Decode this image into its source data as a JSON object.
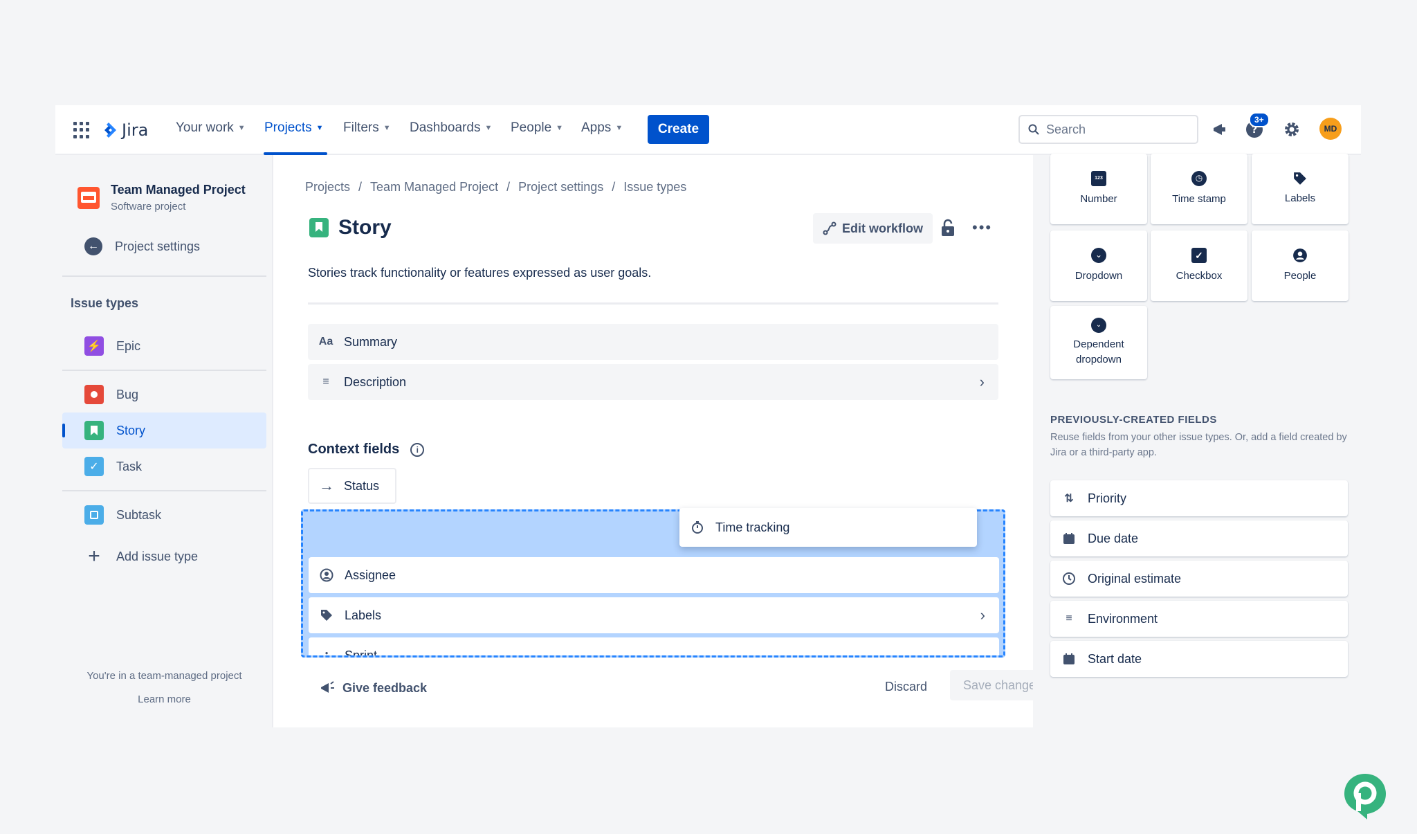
{
  "nav": {
    "logo_text": "Jira",
    "items": [
      {
        "label": "Your work"
      },
      {
        "label": "Projects"
      },
      {
        "label": "Filters"
      },
      {
        "label": "Dashboards"
      },
      {
        "label": "People"
      },
      {
        "label": "Apps"
      }
    ],
    "create_label": "Create",
    "search_placeholder": "Search",
    "notification_badge": "3+",
    "avatar_initials": "MD"
  },
  "sidebar": {
    "project_name": "Team Managed Project",
    "project_type": "Software project",
    "settings_label": "Project settings",
    "section_heading": "Issue types",
    "issue_types": [
      {
        "label": "Epic",
        "color": "#904ee2"
      },
      {
        "label": "Bug",
        "color": "#e5493a"
      },
      {
        "label": "Story",
        "color": "#36b37e"
      },
      {
        "label": "Task",
        "color": "#4bade8"
      },
      {
        "label": "Subtask",
        "color": "#4bade8"
      }
    ],
    "add_label": "Add issue type",
    "footer_text": "You're in a team-managed project",
    "learn_more": "Learn more"
  },
  "main": {
    "breadcrumbs": [
      "Projects",
      "Team Managed Project",
      "Project settings",
      "Issue types"
    ],
    "breadcrumb_sep": "/",
    "title": "Story",
    "edit_workflow_label": "Edit workflow",
    "description": "Stories track functionality or features expressed as user goals.",
    "fields": [
      {
        "label": "Summary",
        "icon": "Aa"
      },
      {
        "label": "Description",
        "icon": "text-lines-icon"
      }
    ],
    "context_heading": "Context fields",
    "status_label": "Status",
    "dragging_label": "Time tracking",
    "context_fields": [
      {
        "label": "Assignee"
      },
      {
        "label": "Labels"
      },
      {
        "label": "Sprint"
      }
    ],
    "feedback_label": "Give feedback",
    "discard_label": "Discard",
    "save_label": "Save changes"
  },
  "panel": {
    "field_types": [
      {
        "label": "Number",
        "icon": "123"
      },
      {
        "label": "Time stamp",
        "icon": "clock-icon"
      },
      {
        "label": "Labels",
        "icon": "tag-icon"
      },
      {
        "label": "Dropdown",
        "icon": "chevron-circle-icon"
      },
      {
        "label": "Checkbox",
        "icon": "checkbox-icon"
      },
      {
        "label": "People",
        "icon": "person-icon"
      },
      {
        "label_line1": "Dependent",
        "label_line2": "dropdown",
        "icon": "double-chevron-icon"
      }
    ],
    "prev_heading": "PREVIOUSLY-CREATED FIELDS",
    "prev_desc": "Reuse fields from your other issue types. Or, add a field created by Jira or a third-party app.",
    "prev_fields": [
      {
        "label": "Priority"
      },
      {
        "label": "Due date"
      },
      {
        "label": "Original estimate"
      },
      {
        "label": "Environment"
      },
      {
        "label": "Start date"
      }
    ]
  },
  "colors": {
    "accent": "#0052cc",
    "dropzone": "#b3d4ff",
    "dropzone_border": "#2684ff",
    "brand_corner": "#36b37e"
  }
}
